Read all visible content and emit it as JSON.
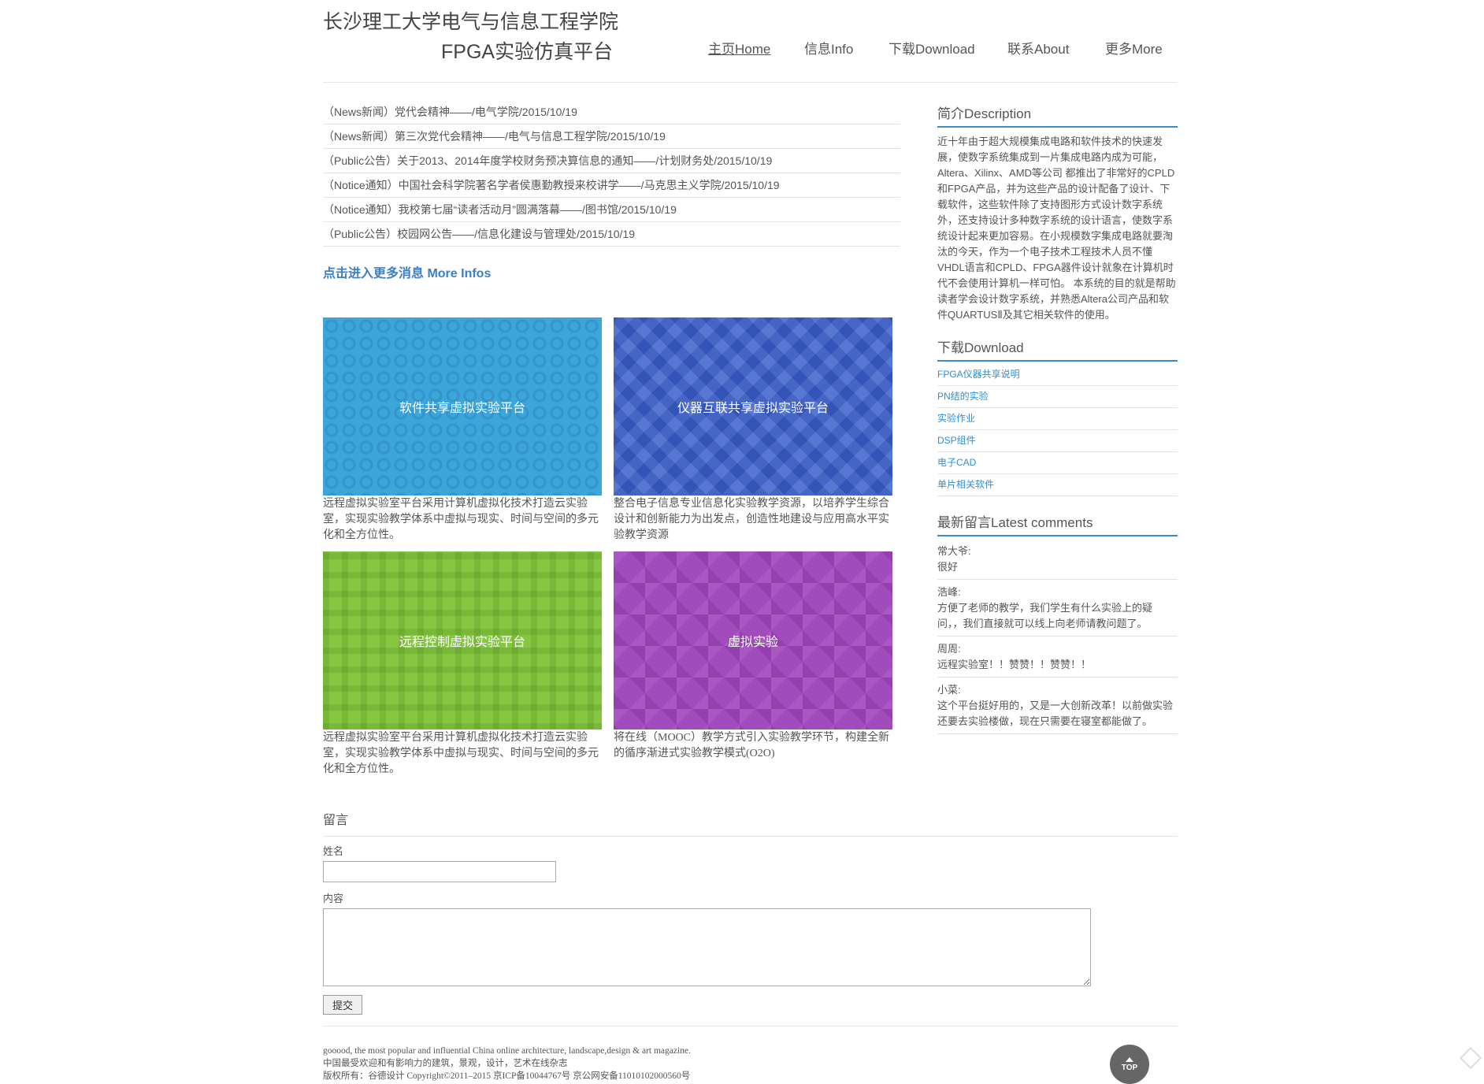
{
  "header": {
    "title_line1": "长沙理工大学电气与信息工程学院",
    "title_line2": "FPGA实验仿真平台",
    "nav": [
      "主页Home",
      "信息Info",
      "下载Download",
      "联系About",
      "更多More"
    ]
  },
  "news": [
    "（News新闻）党代会精神——/电气学院/2015/10/19",
    "（News新闻）第三次党代会精神——/电气与信息工程学院/2015/10/19",
    "（Public公告）关于2013、2014年度学校财务预决算信息的通知——/计划财务处/2015/10/19",
    "（Notice通知）中国社会科学院著名学者侯惠勤教授来校讲学——/马克思主义学院/2015/10/19",
    "（Notice通知）我校第七届“读者活动月”圆满落幕——/图书馆/2015/10/19",
    "（Public公告）校园网公告——/信息化建设与管理处/2015/10/19"
  ],
  "more_link": "点击进入更多消息 More Infos",
  "cards": [
    {
      "title": "软件共享虚拟实验平台",
      "desc": "远程虚拟实验室平台采用计算机虚拟化技术打造云实验室，实现实验教学体系中虚拟与现实、时间与空间的多元化和全方位性。",
      "color": "#3ca5d9"
    },
    {
      "title": "仪器互联共享虚拟实验平台",
      "desc": "整合电子信息专业信息化实验教学资源，以培养学生综合设计和创新能力为出发点，创造性地建设与应用高水平实验教学资源",
      "color": "#3d62cc"
    },
    {
      "title": "远程控制虚拟实验平台",
      "desc": "远程虚拟实验室平台采用计算机虚拟化技术打造云实验室，实现实验教学体系中虚拟与现实、时间与空间的多元化和全方位性。",
      "color": "#86c640"
    },
    {
      "title": "虚拟实验",
      "desc": "将在线（MOOC）教学方式引入实验教学环节，构建全新的循序渐进式实验教学模式(O2O)",
      "color": "#a24bbd"
    }
  ],
  "sidebar": {
    "desc_title": "简介Description",
    "desc_text": "近十年由于超大规模集成电路和软件技术的快速发展，使数字系统集成到一片集成电路内成为可能，Altera、Xilinx、AMD等公司 都推出了非常好的CPLD和FPGA产品，并为这些产品的设计配备了设计、下载软件，这些软件除了支持图形方式设计数字系统外，还支持设计多种数字系统的设计语言，使数字系统设计起来更加容易。在小规模数字集成电路就要淘汰的今天，作为一个电子技术工程技术人员不懂VHDL语言和CPLD、FPGA器件设计就象在计算机时代不会使用计算机一样可怕。 本系统的目的就是帮助读者学会设计数字系统，并熟悉Altera公司产品和软件QUARTUSⅡ及其它相关软件的使用。",
    "download_title": "下载Download",
    "downloads": [
      "FPGA仪器共享说明",
      "PN结的实验",
      "实验作业",
      "DSP组件",
      "电子CAD",
      "单片相关软件"
    ],
    "comments_title": "最新留言Latest comments",
    "comments": [
      {
        "name": "常大爷:",
        "text": "很好"
      },
      {
        "name": "浩峰:",
        "text": "方便了老师的教学，我们学生有什么实验上的疑问，，我们直接就可以线上向老师请教问题了。"
      },
      {
        "name": "周周:",
        "text": "远程实验室！！赞赞！！赞赞！！"
      },
      {
        "name": "小菜:",
        "text": "这个平台挺好用的，又是一大创新改革！以前做实验还要去实验楼做，现在只需要在寝室都能做了。"
      }
    ]
  },
  "form": {
    "title": "留言",
    "name_label": "姓名",
    "content_label": "内容",
    "submit": "提交"
  },
  "footer": {
    "line1": "gooood, the most popular and influential China online architecture, landscape,design & art magazine.",
    "line2": "中国最受欢迎和有影响力的建筑，景观，设计，艺术在线杂志",
    "line3": "版权所有：谷德设计 Copyright©2011–2015 京ICP备10044767号 京公网安备11010102000560号"
  },
  "top_button": "TOP",
  "colors": {
    "accent": "#3e8ac8",
    "link": "#2e8fd6"
  }
}
